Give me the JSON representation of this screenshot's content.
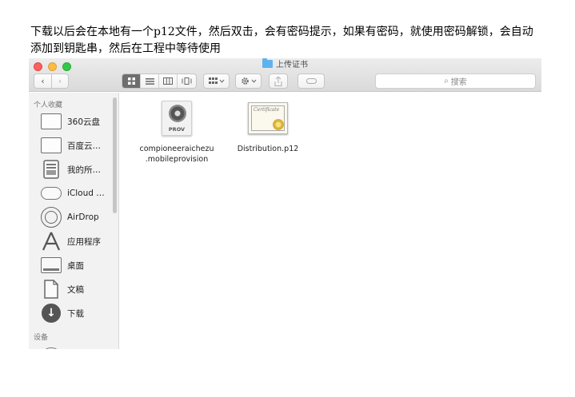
{
  "instruction": {
    "text": "下载以后会在本地有一个p12文件，然后双击，会有密码提示，如果有密码，就使用密码解锁，会自动添加到钥匙串，然后在工程中等待使用"
  },
  "window": {
    "title": "上传证书",
    "search_placeholder": "搜索",
    "nav_back": "‹",
    "nav_forward": "›"
  },
  "sidebar": {
    "favorites_header": "个人收藏",
    "devices_header": "设备",
    "items": [
      {
        "label": "360云盘",
        "icon": "folder-icon"
      },
      {
        "label": "百度云…",
        "icon": "folder-icon"
      },
      {
        "label": "我的所…",
        "icon": "all-files-icon"
      },
      {
        "label": "iCloud …",
        "icon": "icloud-icon"
      },
      {
        "label": "AirDrop",
        "icon": "airdrop-icon"
      },
      {
        "label": "应用程序",
        "icon": "applications-icon"
      },
      {
        "label": "桌面",
        "icon": "desktop-icon"
      },
      {
        "label": "文稿",
        "icon": "documents-icon"
      },
      {
        "label": "下载",
        "icon": "downloads-icon"
      }
    ]
  },
  "files": [
    {
      "name_line1": "compioneeraichezu",
      "name_line2": ".mobileprovision",
      "icon": "provisioning-profile-icon",
      "badge": "PROV"
    },
    {
      "name_line1": "Distribution.p12",
      "name_line2": "",
      "icon": "certificate-icon",
      "badge": "Certificate"
    }
  ],
  "colors": {
    "folder_accent": "#5fb2ee",
    "traffic_red": "#fc615d",
    "traffic_yellow": "#fdbc40",
    "traffic_green": "#34c84a"
  }
}
